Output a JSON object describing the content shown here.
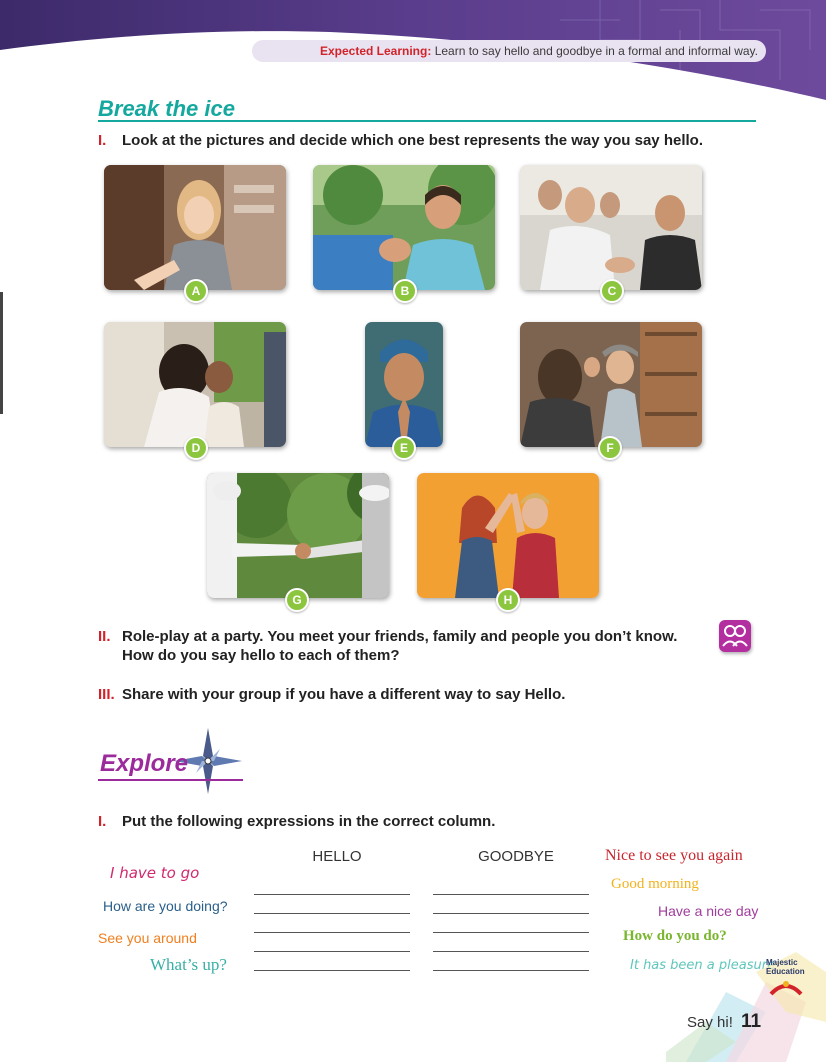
{
  "header": {
    "expected_learning_label": "Expected Learning:",
    "expected_learning_text": "Learn to say hello and goodbye in a formal and informal way."
  },
  "break_the_ice": {
    "title": "Break the ice",
    "q1_num": "I.",
    "q1_text": "Look at the pictures and decide which one best represents the way you say hello.",
    "photos": [
      "A",
      "B",
      "C",
      "D",
      "E",
      "F",
      "G",
      "H"
    ],
    "q2_num": "II.",
    "q2_text_line1": "Role-play at a party. You meet your friends, family and people you don’t know.",
    "q2_text_line2": "How do you say hello to each of them?",
    "q3_num": "III.",
    "q3_text": "Share with your group if you have a different way to say Hello."
  },
  "explore": {
    "title": "Explore",
    "q1_num": "I.",
    "q1_text": "Put the following expressions in the correct column.",
    "columns": [
      "HELLO",
      "GOODBYE"
    ],
    "left_expressions": [
      "I have to go",
      "How are you doing?",
      "See you around",
      "What’s up?"
    ],
    "right_expressions": [
      "Nice to see you again",
      "Good morning",
      "Have a nice day",
      "How do you do?",
      "It has been a pleasure"
    ]
  },
  "colors": {
    "teal": "#14a89e",
    "red": "#d2232a",
    "purple": "#9b2a9b",
    "badge_green": "#8cc63f"
  },
  "footer": {
    "chapter": "Say hi!",
    "page_number": "11",
    "logo_text_1": "Majestic",
    "logo_text_2": "Education"
  }
}
